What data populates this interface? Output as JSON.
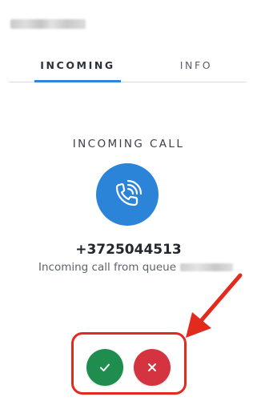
{
  "header": {
    "title_redacted": true
  },
  "tabs": [
    {
      "label": "INCOMING",
      "active": true
    },
    {
      "label": "INFO",
      "active": false
    }
  ],
  "call": {
    "heading": "INCOMING CALL",
    "icon": "phone-ringing-icon",
    "number": "+3725044513",
    "queue_text": "Incoming call from queue"
  },
  "actions": {
    "accept_icon": "check-icon",
    "decline_icon": "close-icon"
  },
  "colors": {
    "accent": "#2d86d8",
    "accept": "#1e8d4e",
    "decline": "#d4343f",
    "annotation": "#e32a1f"
  }
}
